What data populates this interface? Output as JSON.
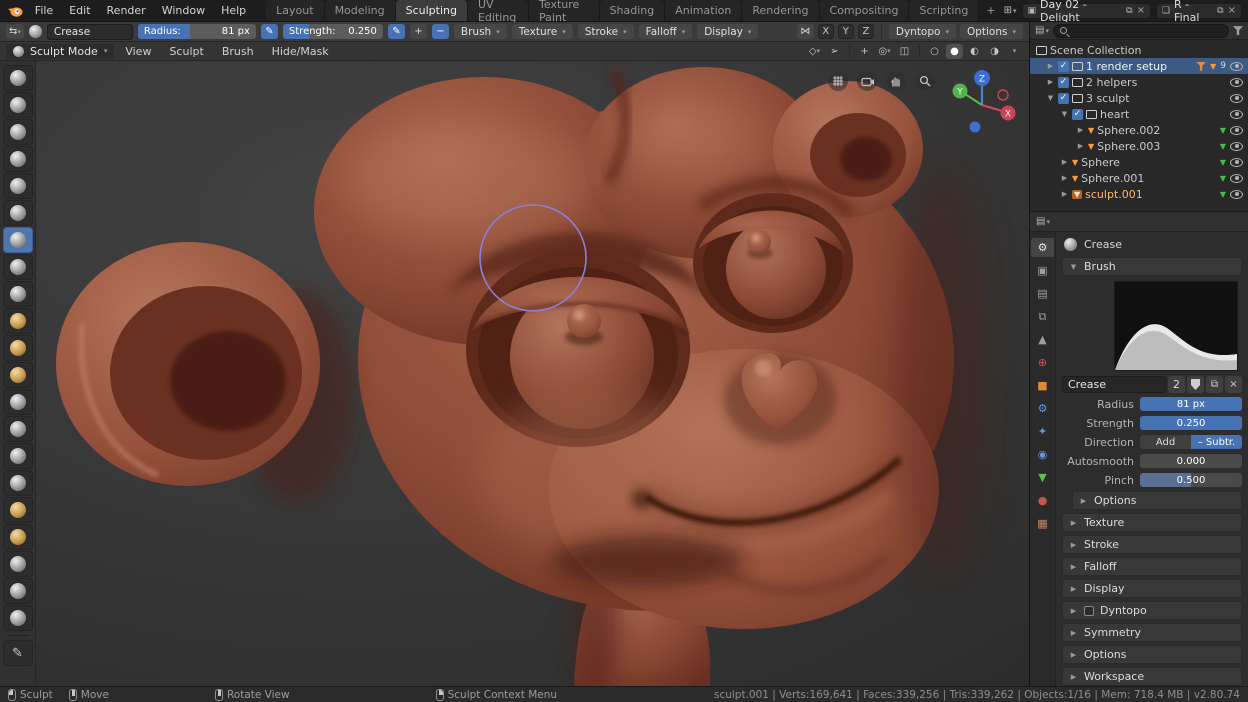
{
  "topbar": {
    "menus": [
      "File",
      "Edit",
      "Render",
      "Window",
      "Help"
    ],
    "workspaces": [
      "Layout",
      "Modeling",
      "Sculpting",
      "UV Editing",
      "Texture Paint",
      "Shading",
      "Animation",
      "Rendering",
      "Compositing",
      "Scripting"
    ],
    "new_workspace": "+",
    "scene_name": "Day 02 - Delight",
    "view_layer_name": "R - Final"
  },
  "tool_header": {
    "brush_name": "Crease",
    "radius_label": "Radius:",
    "radius_value": "81 px",
    "strength_label": "Strength:",
    "strength_value": "0.250",
    "plus": "+",
    "minus": "−",
    "dropdowns": [
      "Brush",
      "Texture",
      "Stroke",
      "Falloff",
      "Display"
    ],
    "axes": [
      "X",
      "Y",
      "Z"
    ],
    "dyntopo": "Dyntopo",
    "options": "Options"
  },
  "viewport_header": {
    "mode": "Sculpt Mode",
    "menus": [
      "View",
      "Sculpt",
      "Brush",
      "Hide/Mask"
    ]
  },
  "viewport": {
    "gizmo": {
      "x": "X",
      "y": "Y",
      "z": "Z"
    }
  },
  "outliner": {
    "root": "Scene Collection",
    "rows": [
      {
        "name": "1 render setup",
        "child_count": "9"
      },
      {
        "name": "2 helpers"
      },
      {
        "name": "3 sculpt"
      },
      {
        "name": "heart"
      },
      {
        "name": "Sphere.002"
      },
      {
        "name": "Sphere.003"
      },
      {
        "name": "Sphere"
      },
      {
        "name": "Sphere.001"
      },
      {
        "name": "sculpt.001"
      }
    ]
  },
  "properties": {
    "breadcrumb": "Crease",
    "brush_panel": "Brush",
    "name_field": "Crease",
    "users": "2",
    "radius_label": "Radius",
    "radius_value": "81 px",
    "strength_label": "Strength",
    "strength_value": "0.250",
    "direction_label": "Direction",
    "direction_add": "Add",
    "direction_subtract": "– Subtr.",
    "autosmooth_label": "Autosmooth",
    "autosmooth_value": "0.000",
    "pinch_label": "Pinch",
    "pinch_value": "0.500",
    "sub_options": "Options",
    "panels": [
      "Texture",
      "Stroke",
      "Falloff",
      "Display",
      "Dyntopo",
      "Symmetry",
      "Options",
      "Workspace"
    ]
  },
  "statusbar": {
    "hints": [
      "Sculpt",
      "Move",
      "Rotate View",
      "Sculpt Context Menu"
    ],
    "stats": "sculpt.001 | Verts:169,641 | Faces:339,256 | Tris:339,262 | Objects:1/16 | Mem: 718.4 MB | v2.80.74"
  }
}
